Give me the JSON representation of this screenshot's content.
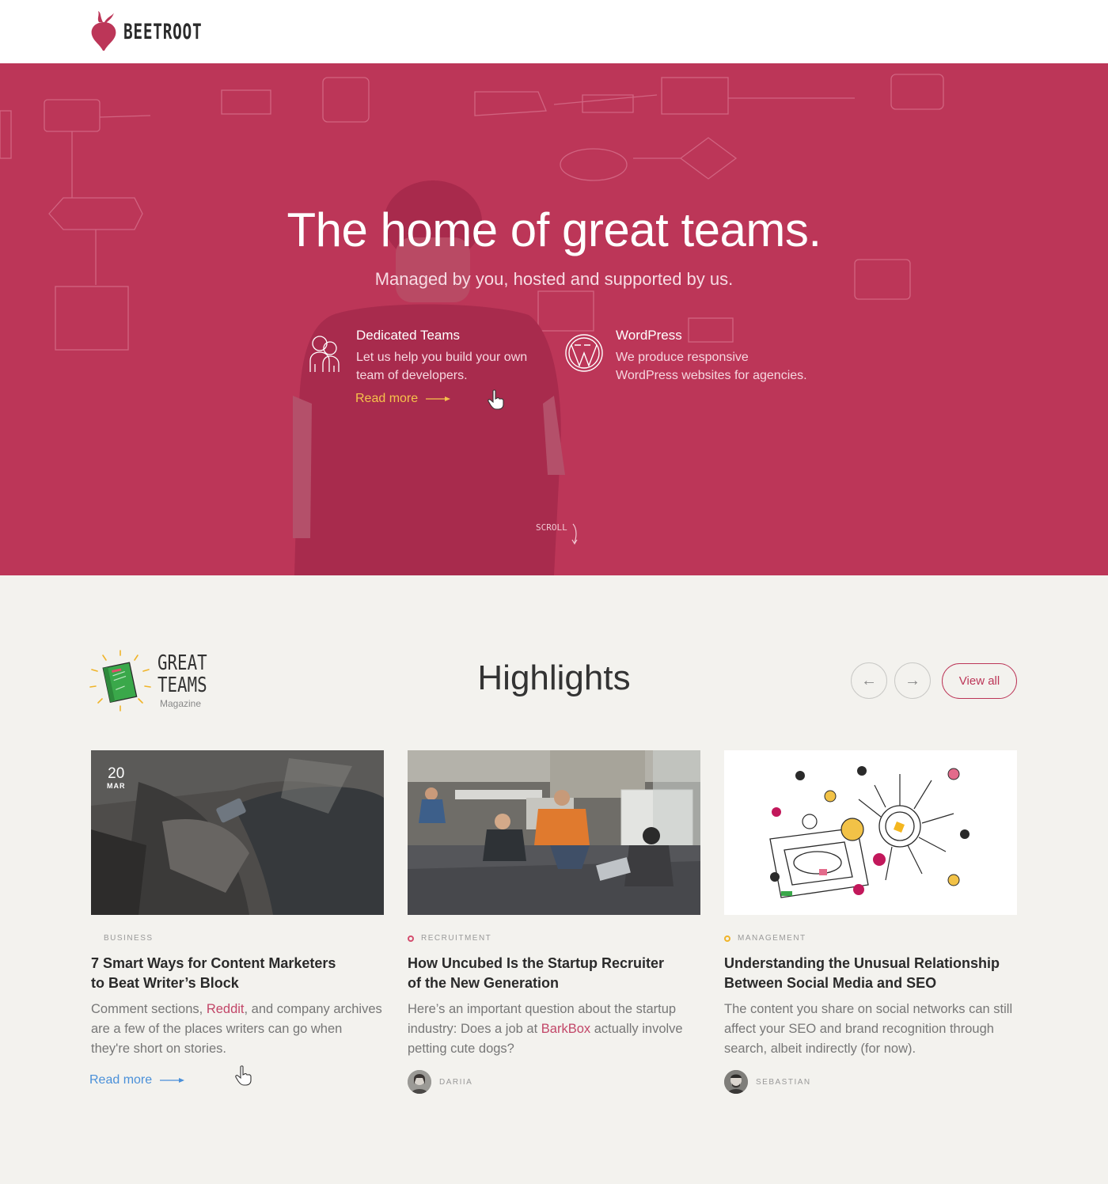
{
  "brand": {
    "name": "BEETROOT",
    "accent": "#bc3658"
  },
  "hero": {
    "title": "The home of great teams.",
    "subtitle": "Managed by you, hosted and supported by us.",
    "features": [
      {
        "icon": "people-icon",
        "title": "Dedicated Teams",
        "desc_line1": "Let us help you build your own",
        "desc_line2": "team of developers.",
        "cta": "Read more"
      },
      {
        "icon": "wordpress-icon",
        "title": "WordPress",
        "desc_line1": "We produce responsive",
        "desc_line2": "WordPress websites for agencies."
      }
    ],
    "scroll_label": "SCROLL"
  },
  "highlights": {
    "magazine_line1": "GREAT",
    "magazine_line2": "TEAMS",
    "magazine_sub": "Magazine",
    "title": "Highlights",
    "prev_label": "←",
    "next_label": "→",
    "view_all": "View all",
    "cards": [
      {
        "date_day": "20",
        "date_month": "MAR",
        "category": "BUSINESS",
        "title_line1": "7 Smart Ways for Content Marketers",
        "title_line2": "to Beat Writer’s Block",
        "excerpt_pre": "Comment sections, ",
        "excerpt_link": "Reddit",
        "excerpt_post": ", and company archives are a few of the places writers can go when they're short on stories.",
        "cta": "Read more"
      },
      {
        "category": "RECRUITMENT",
        "category_color": "#d44d6e",
        "title_line1": "How Uncubed Is the Startup Recruiter",
        "title_line2": "of the New Generation",
        "excerpt_pre": "Here’s an important question about the startup industry: Does a job at ",
        "excerpt_link": "BarkBox",
        "excerpt_post": " actually involve petting cute dogs?",
        "author": "DARIIA"
      },
      {
        "category": "MANAGEMENT",
        "category_color": "#f0b429",
        "title_line1": "Understanding the Unusual Relationship",
        "title_line2": "Between Social Media and SEO",
        "excerpt": "The content you share on social networks can still affect your SEO and brand recognition through search, albeit indirectly (for now).",
        "author": "SEBASTIAN"
      }
    ]
  }
}
